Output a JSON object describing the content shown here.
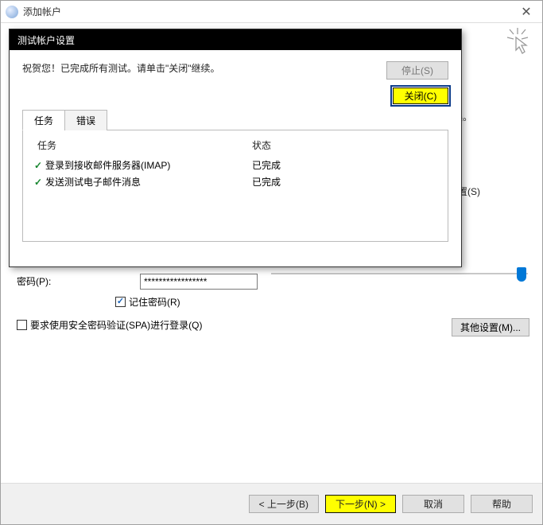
{
  "window": {
    "title": "添加帐户",
    "partial_end_text": "误。",
    "partial_settings_text": "置(S)"
  },
  "cursor_icon": "click-cursor",
  "password": {
    "label": "密码(P):",
    "value": "*****************",
    "remember": "记住密码(R)",
    "spa": "要求使用安全密码验证(SPA)进行登录(Q)"
  },
  "other_settings": "其他设置(M)...",
  "footer": {
    "back": "< 上一步(B)",
    "next": "下一步(N) >",
    "cancel": "取消",
    "help": "帮助"
  },
  "dialog": {
    "title": "测试帐户设置",
    "message": "祝贺您！已完成所有测试。请单击\"关闭\"继续。",
    "stop": "停止(S)",
    "close": "关闭(C)",
    "tabs": {
      "tasks": "任务",
      "errors": "错误"
    },
    "head": {
      "task": "任务",
      "status": "状态"
    },
    "rows": [
      {
        "name": "登录到接收邮件服务器(IMAP)",
        "status": "已完成"
      },
      {
        "name": "发送测试电子邮件消息",
        "status": "已完成"
      }
    ]
  }
}
